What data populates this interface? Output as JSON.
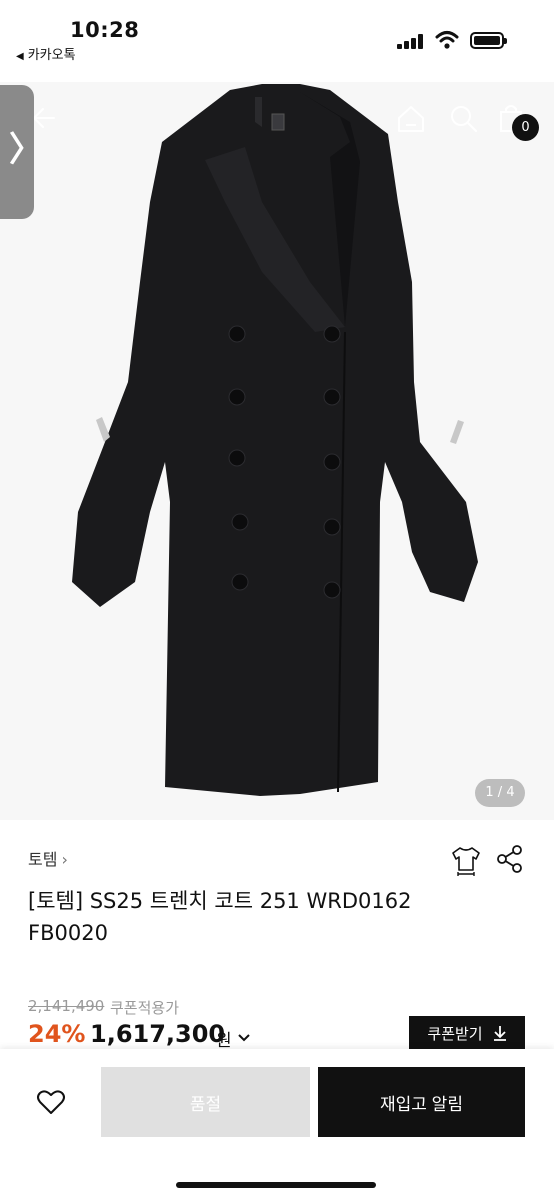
{
  "status_bar": {
    "time": "10:28",
    "back_app_label": "카카오톡"
  },
  "gallery": {
    "counter": "1 / 4",
    "cart_count": "0",
    "icons": [
      "back-arrow-icon",
      "home-icon",
      "search-icon",
      "cart-icon"
    ]
  },
  "product": {
    "brand": "토템",
    "brand_arrow": "›",
    "title": "[토템] SS25 트렌치 코트 251 WRD0162 FB0020",
    "original_price": "2,141,490",
    "coupon_note": "쿠폰적용가",
    "discount": "24%",
    "price": "1,617,300",
    "currency": "원",
    "coupon_button": "쿠폰받기"
  },
  "actions": {
    "soldout_label": "품절",
    "restock_label": "재입고 알림"
  },
  "colors": {
    "discount": "#e0541d",
    "primary_button": "#111111",
    "disabled_button": "#e0e0e0"
  }
}
